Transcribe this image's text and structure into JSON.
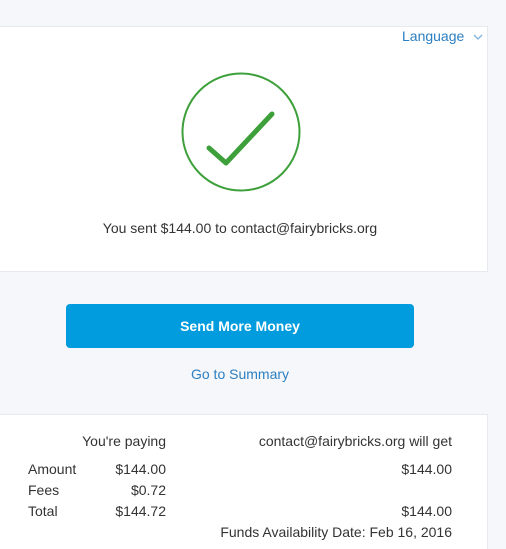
{
  "header": {
    "language_label": "Language"
  },
  "confirmation": {
    "message": "You sent $144.00 to contact@fairybricks.org"
  },
  "actions": {
    "send_more_label": "Send More Money",
    "summary_link": "Go to Summary"
  },
  "summary": {
    "paying_header": "You're paying",
    "recipient_header": "contact@fairybricks.org will get",
    "rows": [
      {
        "label": "Amount",
        "paying": "$144.00",
        "recipient": "$144.00"
      },
      {
        "label": "Fees",
        "paying": "$0.72",
        "recipient": ""
      },
      {
        "label": "Total",
        "paying": "$144.72",
        "recipient": "$144.00"
      }
    ],
    "availability": "Funds Availability Date: Feb 16, 2016"
  },
  "colors": {
    "accent": "#009cde",
    "link": "#2c7fc1",
    "success": "#3da03a"
  }
}
